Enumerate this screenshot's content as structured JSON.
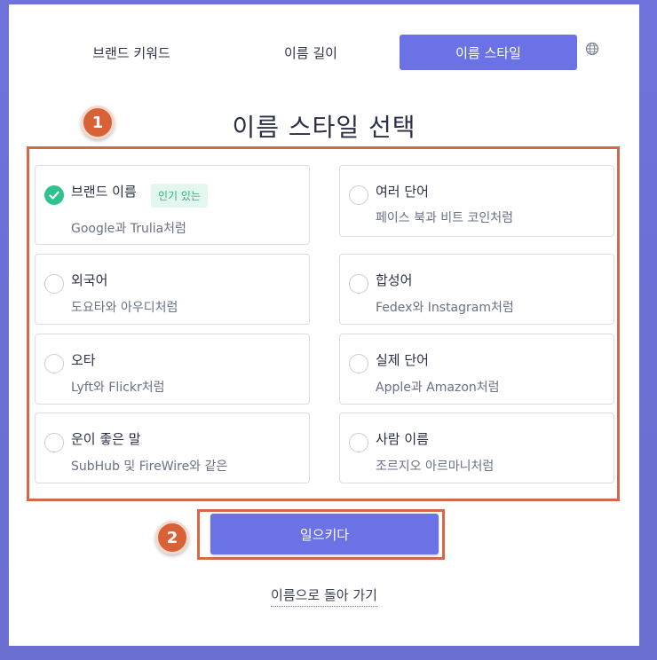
{
  "tabs": [
    {
      "label": "브랜드 키워드"
    },
    {
      "label": "이름 길이"
    },
    {
      "label": "이름 스타일"
    }
  ],
  "active_tab": "이름 스타일",
  "globe_icon": "globe-icon",
  "title": "이름 스타일 선택",
  "callouts": [
    "1",
    "2"
  ],
  "options": [
    {
      "name": "브랜드 이름",
      "badge": "인기 있는",
      "desc": "Google과 Trulia처럼",
      "checked": true
    },
    {
      "name": "여러 단어",
      "desc": "페이스 북과 비트 코인처럼",
      "checked": false
    },
    {
      "name": "외국어",
      "desc": "도요타와 아우디처럼",
      "checked": false
    },
    {
      "name": "합성어",
      "desc": "Fedex와 Instagram처럼",
      "checked": false
    },
    {
      "name": "오타",
      "desc": "Lyft와 Flickr처럼",
      "checked": false
    },
    {
      "name": "실제 단어",
      "desc": "Apple과 Amazon처럼",
      "checked": false
    },
    {
      "name": "운이 좋은 말",
      "desc": "SubHub 및 FireWire와 같은",
      "checked": false
    },
    {
      "name": "사람 이름",
      "desc": "조르지오 아르마니처럼",
      "checked": false
    }
  ],
  "generate_label": "일으키다",
  "back_label": "이름으로 돌아 가기",
  "colors": {
    "accent": "#6a72e6",
    "check": "#2cc38c",
    "annotation": "#d26a4a"
  }
}
